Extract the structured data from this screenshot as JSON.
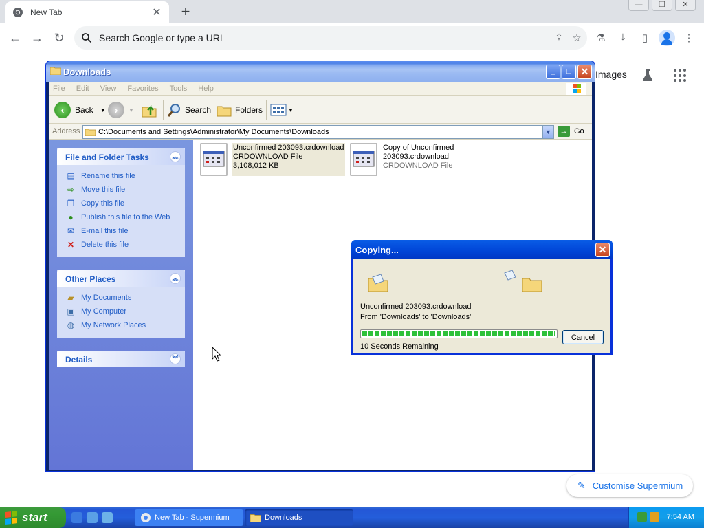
{
  "browser": {
    "tab_title": "New Tab",
    "tab_close": "✕",
    "new_tab": "+",
    "omnibox_placeholder": "Search Google or type a URL",
    "window_buttons": [
      "—",
      "❐",
      "✕"
    ]
  },
  "ntp": {
    "images_link": "Images",
    "customise_label": "Customise Supermium"
  },
  "explorer": {
    "title": "Downloads",
    "menu": [
      "File",
      "Edit",
      "View",
      "Favorites",
      "Tools",
      "Help"
    ],
    "toolbar": {
      "back": "Back",
      "search": "Search",
      "folders": "Folders"
    },
    "address_label": "Address",
    "address_value": "C:\\Documents and Settings\\Administrator\\My Documents\\Downloads",
    "go_label": "Go",
    "file_tasks": {
      "title": "File and Folder Tasks",
      "items": [
        "Rename this file",
        "Move this file",
        "Copy this file",
        "Publish this file to the Web",
        "E-mail this file",
        "Delete this file"
      ]
    },
    "other_places": {
      "title": "Other Places",
      "items": [
        "My Documents",
        "My Computer",
        "My Network Places"
      ]
    },
    "details": {
      "title": "Details"
    },
    "files": [
      {
        "name": "Unconfirmed 203093.crdownload",
        "type": "CRDOWNLOAD File",
        "size": "3,108,012 KB"
      },
      {
        "name_line1": "Copy of Unconfirmed",
        "name_line2": "203093.crdownload",
        "type": "CRDOWNLOAD File"
      }
    ]
  },
  "copy_dialog": {
    "title": "Copying...",
    "filename": "Unconfirmed 203093.crdownload",
    "from_to": "From 'Downloads' to 'Downloads'",
    "progress": 1.0,
    "remaining": "10 Seconds Remaining",
    "cancel_label": "Cancel"
  },
  "taskbar": {
    "start_label": "start",
    "items": [
      "New Tab - Supermium",
      "Downloads"
    ],
    "clock": "7:54 AM"
  },
  "colors": {
    "xp_blue": "#0831d9",
    "task_link": "#215dc6",
    "progress_green": "#2ec13a",
    "chrome_accent": "#1a73e8"
  }
}
